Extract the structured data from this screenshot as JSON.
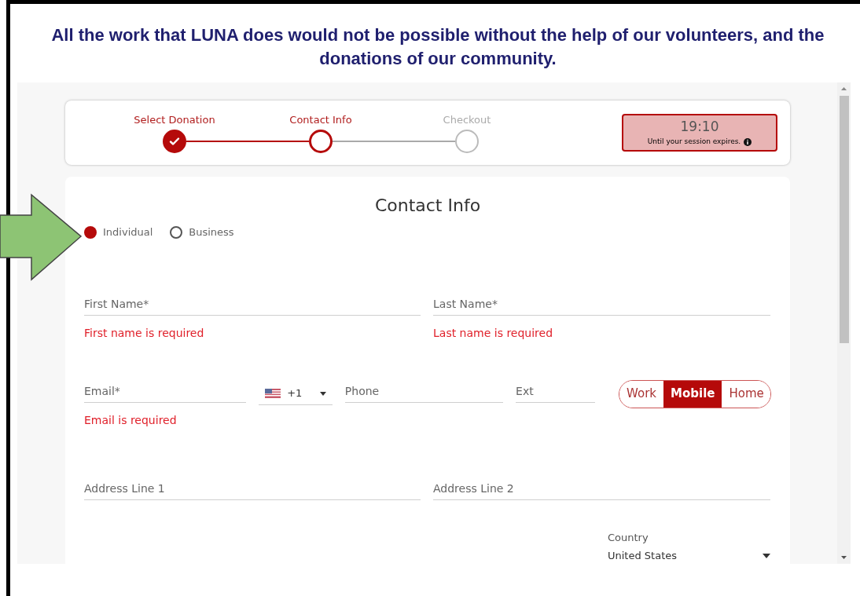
{
  "banner": "All the work that LUNA does would not be possible without the help of our volunteers, and the donations of our community.",
  "steps": [
    {
      "label": "Select Donation",
      "kind": "completed"
    },
    {
      "label": "Contact Info",
      "kind": "current"
    },
    {
      "label": "Checkout",
      "kind": "upcoming"
    }
  ],
  "timer": {
    "time": "19:10",
    "caption": "Until your session expires."
  },
  "form": {
    "title": "Contact Info",
    "donor_types": [
      {
        "label": "Individual",
        "selected": true
      },
      {
        "label": "Business",
        "selected": false
      }
    ],
    "first_name": {
      "placeholder": "First Name*",
      "error": "First name is required"
    },
    "last_name": {
      "placeholder": "Last Name*",
      "error": "Last name is required"
    },
    "email": {
      "placeholder": "Email*",
      "error": "Email is required"
    },
    "country_code": "+1",
    "phone": {
      "placeholder": "Phone"
    },
    "ext": {
      "placeholder": "Ext"
    },
    "phone_types": [
      {
        "label": "Work",
        "selected": false
      },
      {
        "label": "Mobile",
        "selected": true
      },
      {
        "label": "Home",
        "selected": false
      }
    ],
    "address_1": {
      "placeholder": "Address Line 1"
    },
    "address_2": {
      "placeholder": "Address Line 2"
    },
    "country": {
      "label": "Country",
      "value": "United States"
    }
  }
}
